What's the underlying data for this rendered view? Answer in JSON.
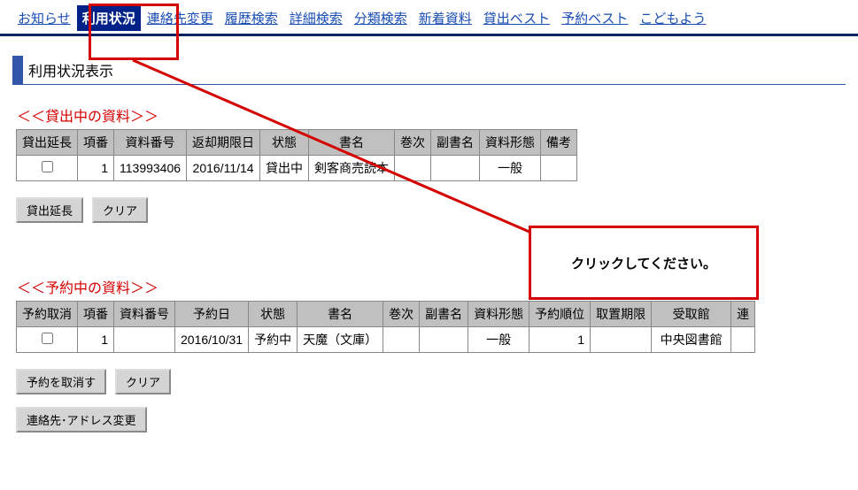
{
  "tabs": {
    "t0": "お知らせ",
    "t1": "利用状況",
    "t2": "連絡先変更",
    "t3": "履歴検索",
    "t4": "詳細検索",
    "t5": "分類検索",
    "t6": "新着資料",
    "t7": "貸出ベスト",
    "t8": "予約ベスト",
    "t9": "こどもよう"
  },
  "page_title": "利用状況表示",
  "section1": {
    "label": "＜＜貸出中の資料＞＞",
    "headers": {
      "h0": "貸出延長",
      "h1": "項番",
      "h2": "資料番号",
      "h3": "返却期限日",
      "h4": "状態",
      "h5": "書名",
      "h6": "巻次",
      "h7": "副書名",
      "h8": "資料形態",
      "h9": "備考"
    },
    "row": {
      "num": "1",
      "material_no": "113993406",
      "return_date": "2016/11/14",
      "status": "貸出中",
      "title": "剣客商売読本",
      "vol": "",
      "subtitle": "",
      "type": "一般",
      "remarks": ""
    },
    "buttons": {
      "extend": "貸出延長",
      "clear": "クリア"
    }
  },
  "callout": "クリックしてください。",
  "section2": {
    "label": "＜＜予約中の資料＞＞",
    "headers": {
      "h0": "予約取消",
      "h1": "項番",
      "h2": "資料番号",
      "h3": "予約日",
      "h4": "状態",
      "h5": "書名",
      "h6": "巻次",
      "h7": "副書名",
      "h8": "資料形態",
      "h9": "予約順位",
      "h10": "取置期限",
      "h11": "受取館",
      "h12": "連"
    },
    "row": {
      "num": "1",
      "material_no": "",
      "reserve_date": "2016/10/31",
      "status": "予約中",
      "title": "天魔（文庫）",
      "vol": "",
      "subtitle": "",
      "type": "一般",
      "order": "1",
      "hold": "",
      "pickup": "中央図書館",
      "extra": ""
    },
    "buttons": {
      "cancel": "予約を取消す",
      "clear": "クリア",
      "contact": "連絡先･アドレス変更"
    }
  }
}
